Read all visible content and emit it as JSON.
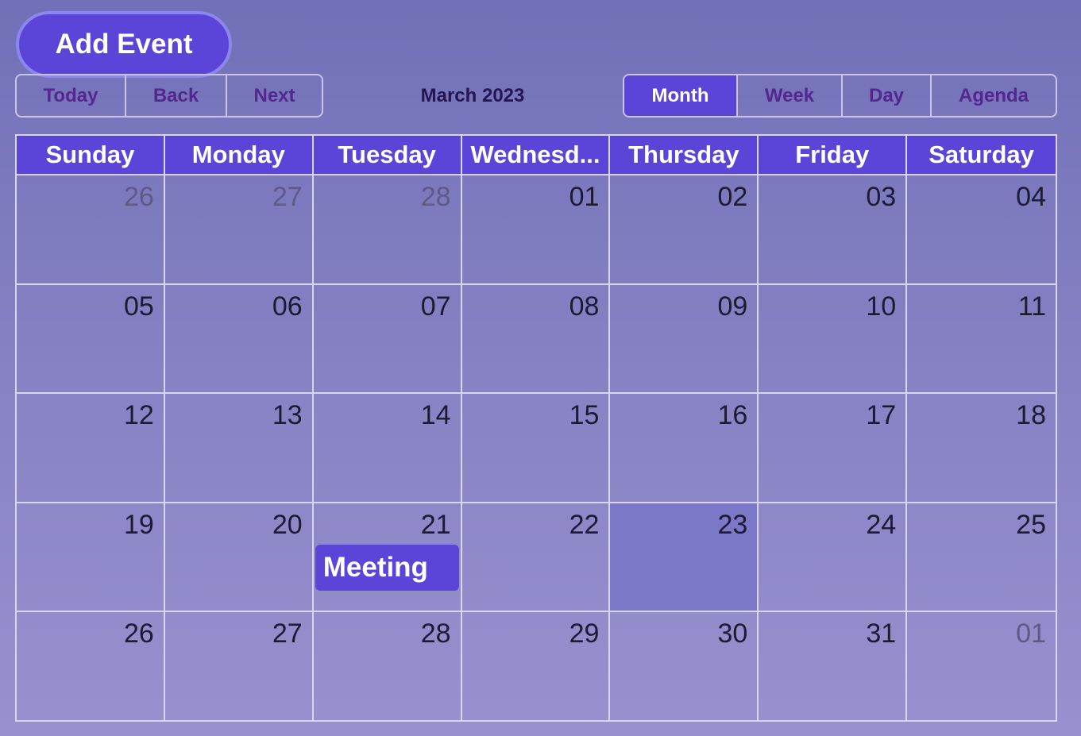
{
  "add_event_label": "Add Event",
  "nav": {
    "today": "Today",
    "back": "Back",
    "next": "Next"
  },
  "toolbar_label": "March 2023",
  "views": {
    "month": "Month",
    "week": "Week",
    "day": "Day",
    "agenda": "Agenda",
    "active": "Month"
  },
  "weekdays": [
    "Sunday",
    "Monday",
    "Tuesday",
    "Wednesd...",
    "Thursday",
    "Friday",
    "Saturday"
  ],
  "weeks": [
    [
      {
        "d": "26",
        "off": true
      },
      {
        "d": "27",
        "off": true
      },
      {
        "d": "28",
        "off": true
      },
      {
        "d": "01"
      },
      {
        "d": "02"
      },
      {
        "d": "03"
      },
      {
        "d": "04"
      }
    ],
    [
      {
        "d": "05"
      },
      {
        "d": "06"
      },
      {
        "d": "07"
      },
      {
        "d": "08"
      },
      {
        "d": "09"
      },
      {
        "d": "10"
      },
      {
        "d": "11"
      }
    ],
    [
      {
        "d": "12"
      },
      {
        "d": "13"
      },
      {
        "d": "14"
      },
      {
        "d": "15"
      },
      {
        "d": "16"
      },
      {
        "d": "17"
      },
      {
        "d": "18"
      }
    ],
    [
      {
        "d": "19"
      },
      {
        "d": "20"
      },
      {
        "d": "21",
        "event": "Meeting"
      },
      {
        "d": "22"
      },
      {
        "d": "23",
        "today": true
      },
      {
        "d": "24"
      },
      {
        "d": "25"
      }
    ],
    [
      {
        "d": "26"
      },
      {
        "d": "27"
      },
      {
        "d": "28"
      },
      {
        "d": "29"
      },
      {
        "d": "30"
      },
      {
        "d": "31"
      },
      {
        "d": "01",
        "off": true
      }
    ]
  ],
  "colors": {
    "accent": "#5b45d8",
    "today_highlight": "#7b78c8",
    "nav_text": "#55268e"
  }
}
